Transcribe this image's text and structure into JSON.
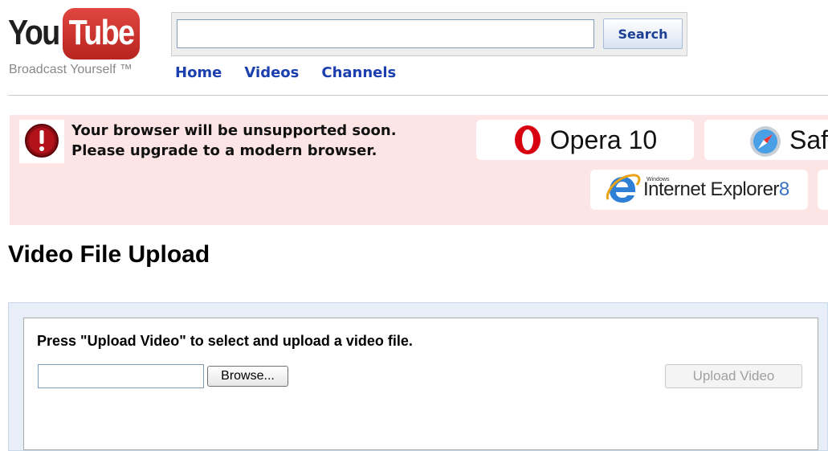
{
  "header": {
    "logo_you": "You",
    "logo_tube": "Tube",
    "tagline": "Broadcast Yourself ™",
    "search": {
      "value": "",
      "placeholder": "",
      "button_label": "Search"
    },
    "nav": [
      {
        "label": "Home"
      },
      {
        "label": "Videos"
      },
      {
        "label": "Channels"
      }
    ]
  },
  "banner": {
    "message_line1": "Your browser will be unsupported soon.",
    "message_line2": "Please upgrade to a modern browser.",
    "icon": "alert-icon",
    "browsers": [
      {
        "name": "Opera 10",
        "icon": "opera-logo"
      },
      {
        "name": "Safari",
        "visible_text": "Saf",
        "icon": "safari-logo"
      },
      {
        "name": "Internet Explorer 8",
        "prefix": "Windows",
        "main": "Internet Explorer",
        "version": "8",
        "icon": "ie-logo"
      }
    ]
  },
  "main": {
    "title": "Video File Upload",
    "instruction": "Press \"Upload Video\" to select and upload a video file.",
    "file_value": "",
    "browse_label": "Browse...",
    "upload_label": "Upload Video",
    "upload_enabled": false
  },
  "colors": {
    "brand_red": "#c4302b",
    "link_blue": "#1c3fb0",
    "banner_bg": "#fde5e5",
    "panel_bg": "#e8eef7"
  }
}
